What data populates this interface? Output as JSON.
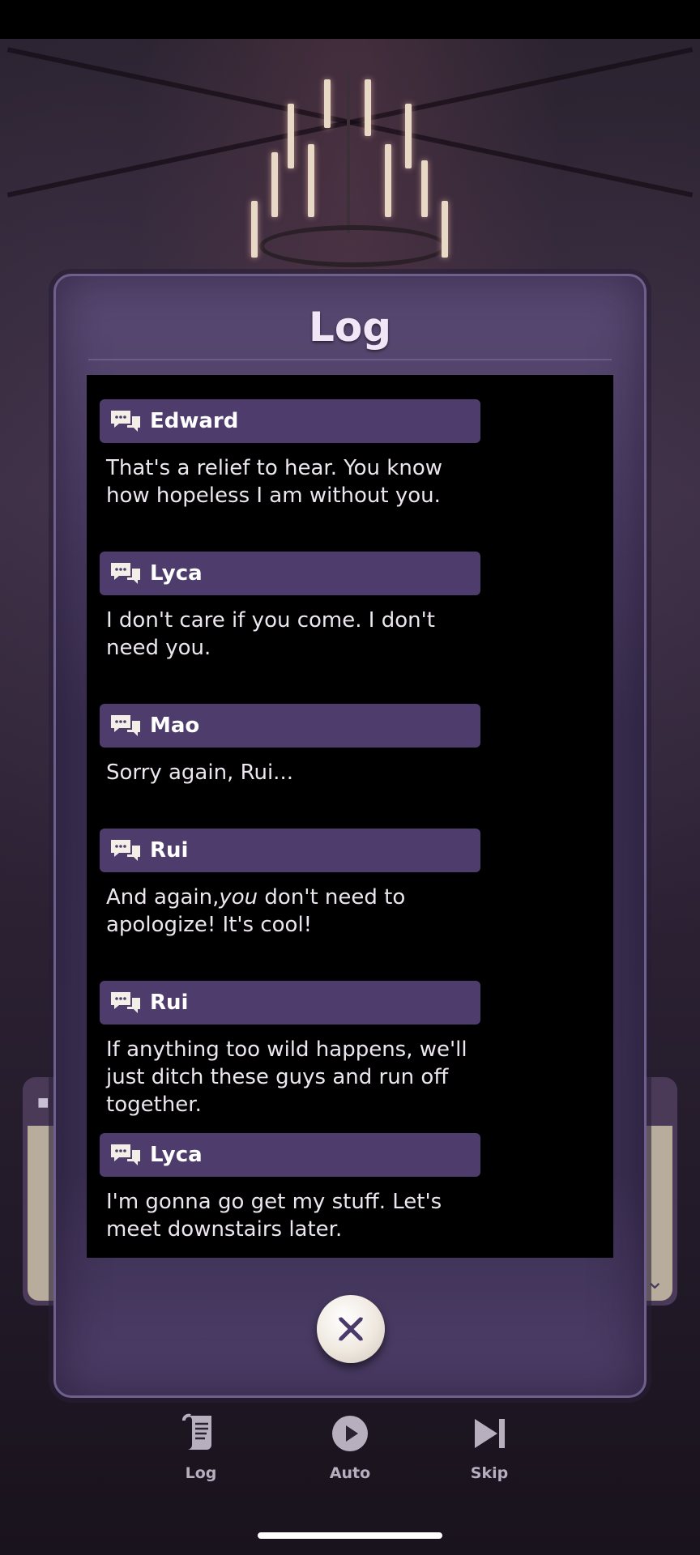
{
  "log": {
    "title": "Log",
    "entries": [
      {
        "speaker": "Edward",
        "text": "That's a relief to hear. You know how hopeless I am without you."
      },
      {
        "speaker": "Lyca",
        "text": "I don't care if you come. I don't need you."
      },
      {
        "speaker": "Mao",
        "text": "Sorry again, Rui..."
      },
      {
        "speaker": "Rui",
        "text_before": "And again,",
        "text_italic": "you",
        "text_after": " don't need to apologize! It's cool!"
      },
      {
        "speaker": "Rui",
        "text": "If anything too wild happens, we'll just ditch these guys and run off together."
      },
      {
        "speaker": "Lyca",
        "text": "I'm gonna go get my stuff. Let's meet downstairs later."
      }
    ]
  },
  "controls": {
    "log": "Log",
    "auto": "Auto",
    "skip": "Skip"
  },
  "icons": {
    "speech": "speech-bubbles-icon",
    "close": "close-icon",
    "log": "scroll-icon",
    "auto": "play-icon",
    "skip": "skip-icon"
  },
  "colors": {
    "accent": "#4e3d6c",
    "panel": "#3b2f52"
  }
}
